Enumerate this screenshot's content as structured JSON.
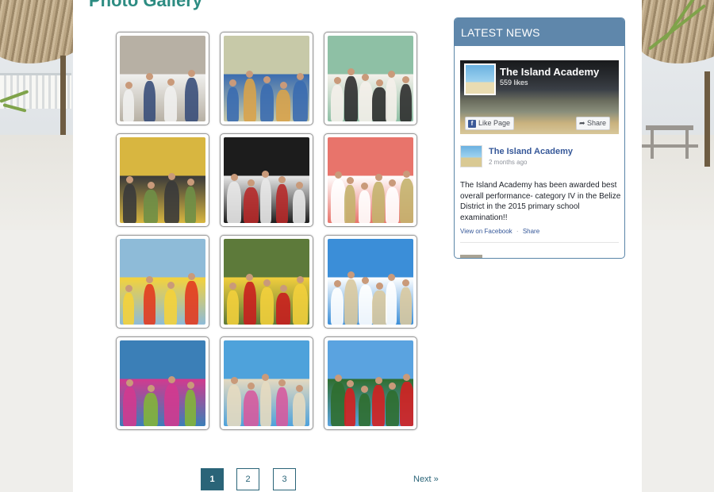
{
  "page": {
    "title": "Photo Gallery"
  },
  "gallery": {
    "photos": [
      {
        "alt": "Group of students in front of school building",
        "palette": [
          "#b7b0a4",
          "#3a4f7a",
          "#f0f0ee"
        ]
      },
      {
        "alt": "Teacher with children in classroom",
        "palette": [
          "#c7c9a8",
          "#d8a34b",
          "#3a6cb0"
        ]
      },
      {
        "alt": "Students gathered around table",
        "palette": [
          "#8ec0a5",
          "#2f2f2f",
          "#f4f0ea"
        ]
      },
      {
        "alt": "Group on porch of yellow house",
        "palette": [
          "#d8b640",
          "#6f8f46",
          "#3a3a3a"
        ]
      },
      {
        "alt": "Children in pirate costumes at night",
        "palette": [
          "#1c1c1c",
          "#b62a2a",
          "#e8e8e8"
        ]
      },
      {
        "alt": "Women under red tent",
        "palette": [
          "#e8746b",
          "#c4b36e",
          "#ffffff"
        ]
      },
      {
        "alt": "Children with balloons",
        "palette": [
          "#8ebbd8",
          "#e23b20",
          "#f4d23b"
        ]
      },
      {
        "alt": "Carnival dancers in red costumes",
        "palette": [
          "#5d7a3a",
          "#c81f1f",
          "#f2cf3c"
        ]
      },
      {
        "alt": "The Island Academy sign on beach",
        "palette": [
          "#3b8ed8",
          "#d9c9a0",
          "#ffffff"
        ]
      },
      {
        "alt": "Children in costumes by blue house",
        "palette": [
          "#3b7fb7",
          "#83b43a",
          "#d13a8f"
        ]
      },
      {
        "alt": "Children in fairy and princess costumes",
        "palette": [
          "#4ea2db",
          "#d65b9f",
          "#e5dac0"
        ]
      },
      {
        "alt": "Children in red shirts under palms",
        "palette": [
          "#5aa3e0",
          "#d32020",
          "#2f6e2f"
        ]
      }
    ]
  },
  "pagination": {
    "pages": [
      "1",
      "2",
      "3"
    ],
    "current": "1",
    "next_label": "Next »"
  },
  "news": {
    "header": "LATEST NEWS",
    "facebook": {
      "page_name": "The Island Academy",
      "likes": "559 likes",
      "like_button": "Like Page",
      "share_button": "Share",
      "post": {
        "author": "The Island Academy",
        "time": "2 months ago",
        "text": "The Island Academy has been awarded best overall performance- category IV in the Belize District in the 2015 primary school examination!!",
        "view_link": "View on Facebook",
        "separator": "·",
        "share_link": "Share"
      }
    }
  },
  "colors": {
    "accent": "#2a6478",
    "news_header": "#5f87ab",
    "title": "#2d8c82",
    "facebook_link": "#365899"
  }
}
